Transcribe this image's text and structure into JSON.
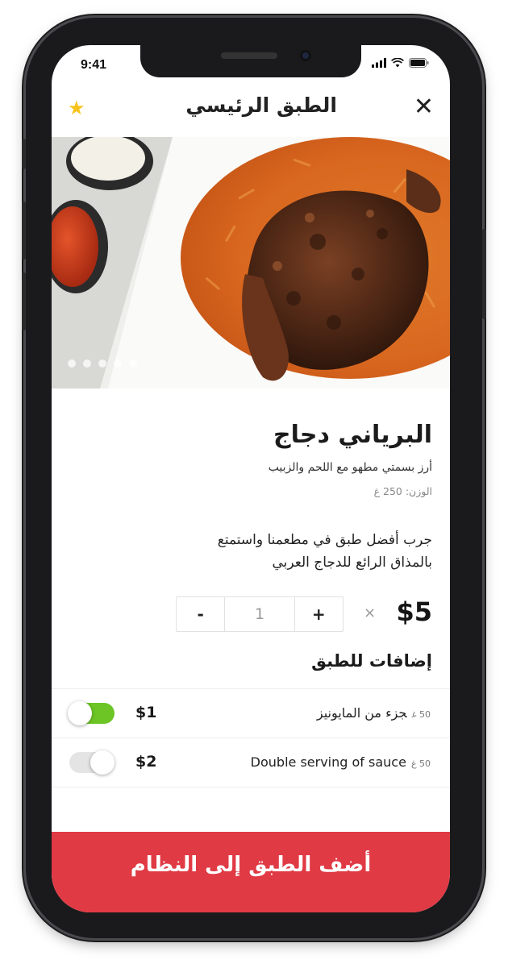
{
  "status": {
    "time": "9:41"
  },
  "header": {
    "title": "الطبق الرئيسي",
    "close_icon": "close-icon",
    "favorite_icon": "star-icon",
    "star_color": "#f7c31a"
  },
  "gallery": {
    "dot_count": 5
  },
  "dish": {
    "name": "البرياني دجاج",
    "short_description": "أرز بسمتي مطهو مع اللحم والزبيب",
    "weight": "الوزن: 250 غ",
    "long_description": "جرب أفضل طبق في مطعمنا واستمتع بالمذاق الرائع للدجاج العربي",
    "price": "$5",
    "multiply": "×"
  },
  "quantity": {
    "minus": "-",
    "value": "1",
    "plus": "+"
  },
  "extras": {
    "title": "إضافات للطبق",
    "items": [
      {
        "name": "جزء من المايونيز",
        "weight": "50 غ",
        "price": "$1",
        "enabled": true
      },
      {
        "name": "Double serving of sauce",
        "weight": "50 غ",
        "price": "$2",
        "enabled": false
      }
    ]
  },
  "cta": {
    "label": "أضف الطبق إلى النظام",
    "color": "#e03a45"
  },
  "colors": {
    "toggle_on": "#6cc524",
    "toggle_off": "#e4e4e4"
  }
}
